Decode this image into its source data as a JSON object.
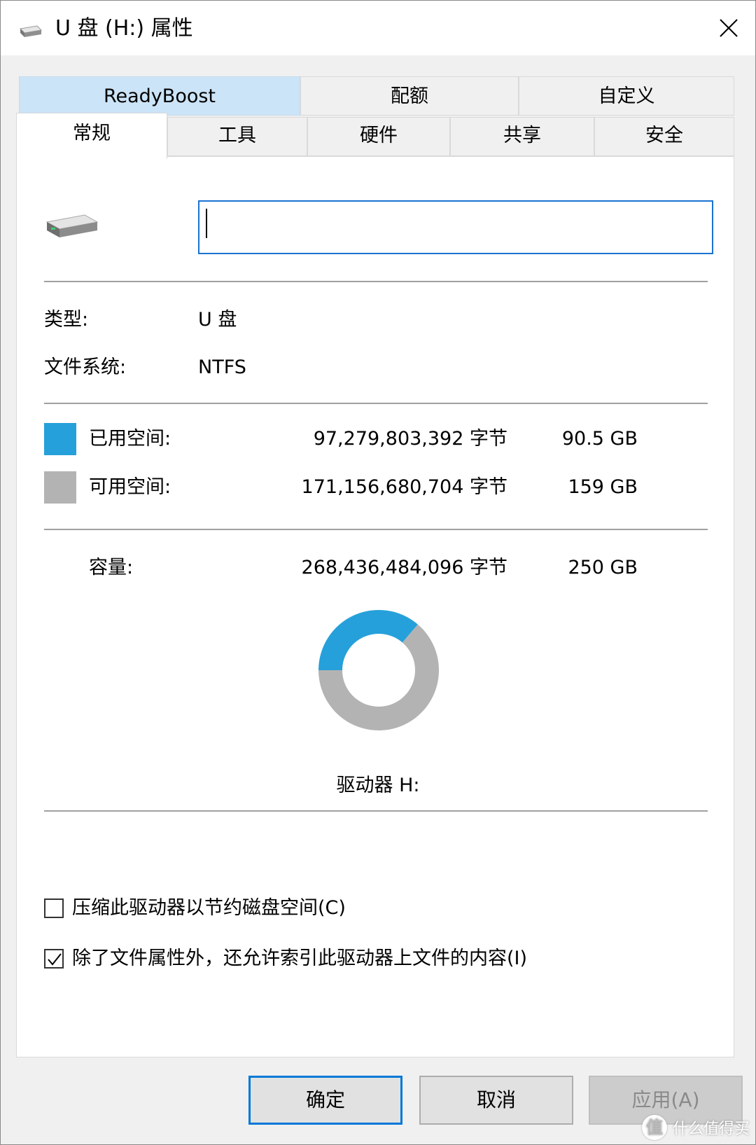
{
  "window": {
    "title": "U 盘 (H:) 属性",
    "close_icon": "close-icon"
  },
  "tabs": {
    "row1": [
      {
        "label": "ReadyBoost"
      },
      {
        "label": "配额"
      },
      {
        "label": "自定义"
      }
    ],
    "row2": [
      {
        "label": "常规",
        "active": true
      },
      {
        "label": "工具"
      },
      {
        "label": "硬件"
      },
      {
        "label": "共享"
      },
      {
        "label": "安全"
      }
    ]
  },
  "general": {
    "name_value": "",
    "type_label": "类型:",
    "type_value": "U 盘",
    "fs_label": "文件系统:",
    "fs_value": "NTFS",
    "used": {
      "label": "已用空间:",
      "bytes": "97,279,803,392 字节",
      "size": "90.5 GB",
      "color": "#26a0da"
    },
    "free": {
      "label": "可用空间:",
      "bytes": "171,156,680,704 字节",
      "size": "159 GB",
      "color": "#b3b3b3"
    },
    "capacity": {
      "label": "容量:",
      "bytes": "268,436,484,096 字节",
      "size": "250 GB"
    },
    "used_fraction": 0.3624,
    "drive_label": "驱动器 H:",
    "compress_option": {
      "label": "压缩此驱动器以节约磁盘空间(C)",
      "checked": false
    },
    "index_option": {
      "label": "除了文件属性外，还允许索引此驱动器上文件的内容(I)",
      "checked": true
    }
  },
  "buttons": {
    "ok": "确定",
    "cancel": "取消",
    "apply": "应用(A)"
  },
  "watermark": {
    "badge": "值",
    "text": "什么值得买"
  }
}
